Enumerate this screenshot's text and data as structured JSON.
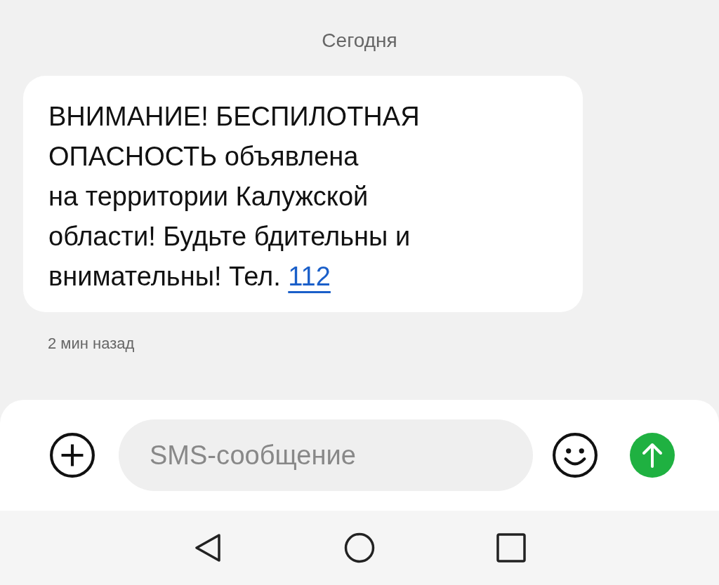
{
  "date_header": "Сегодня",
  "message": {
    "body": "ВНИМАНИЕ! БЕСПИЛОТНАЯ\nОПАСНОСТЬ объявлена\nна территории Калужской\nобласти! Будьте бдительны и\nвнимательны! Тел. ",
    "link": "112",
    "time": "2 мин назад"
  },
  "composer": {
    "placeholder": "SMS-сообщение"
  }
}
